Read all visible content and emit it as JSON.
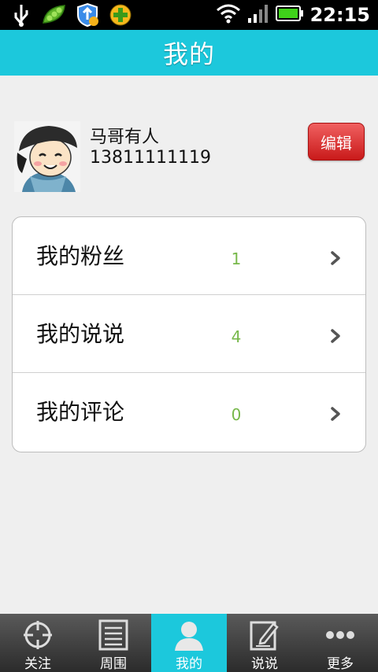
{
  "statusbar": {
    "time": "22:15",
    "icons": [
      "usb-icon",
      "peas-app-icon",
      "security-shield-icon",
      "plus-app-icon",
      "wifi-icon",
      "signal-icon",
      "battery-icon"
    ]
  },
  "title": "我的",
  "profile": {
    "name": "马哥有人",
    "phone": "13811111119",
    "edit_label": "编辑"
  },
  "list": [
    {
      "label": "我的粉丝",
      "count": "1"
    },
    {
      "label": "我的说说",
      "count": "4"
    },
    {
      "label": "我的评论",
      "count": "0"
    }
  ],
  "nav": [
    {
      "label": "关注",
      "icon": "crosshair-icon",
      "active": false
    },
    {
      "label": "周围",
      "icon": "list-icon",
      "active": false
    },
    {
      "label": "我的",
      "icon": "user-icon",
      "active": true
    },
    {
      "label": "说说",
      "icon": "compose-icon",
      "active": false
    },
    {
      "label": "更多",
      "icon": "more-dots-icon",
      "active": false
    }
  ],
  "colors": {
    "accent": "#1cc8dc",
    "edit_button": "#d42b2b",
    "count_text": "#77b84a"
  }
}
